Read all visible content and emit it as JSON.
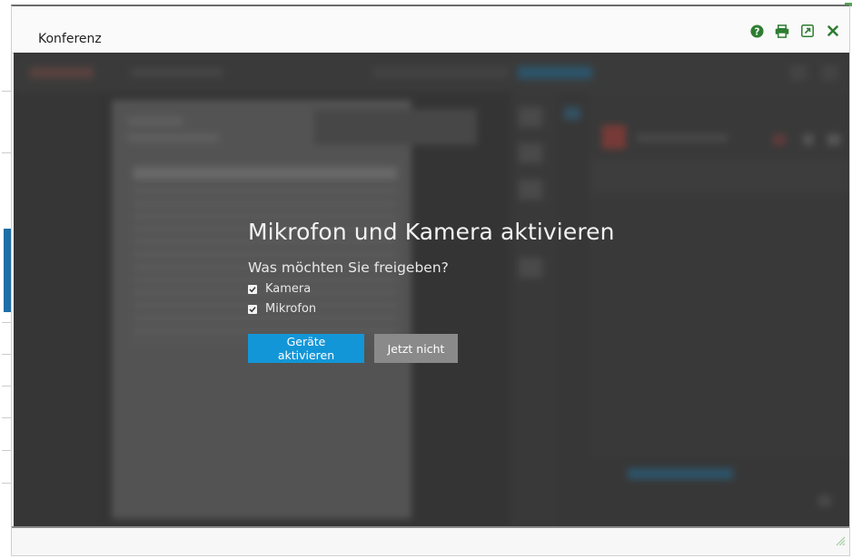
{
  "dialog": {
    "title": "Konferenz"
  },
  "toolbar": {
    "help_icon": "help-icon",
    "print_icon": "print-icon",
    "popout_icon": "popout-icon",
    "close_icon": "close-icon"
  },
  "modal": {
    "title": "Mikrofon und Kamera aktivieren",
    "subtitle": "Was möchten Sie freigeben?",
    "options": [
      {
        "label": "Kamera",
        "checked": true
      },
      {
        "label": "Mikrofon",
        "checked": true
      }
    ],
    "primary_button": "Geräte aktivieren",
    "secondary_button": "Jetzt nicht"
  },
  "colors": {
    "accent": "#1396d7",
    "toolbar_icons": "#2e7d32",
    "overlay_bg": "#3c3c3c"
  }
}
